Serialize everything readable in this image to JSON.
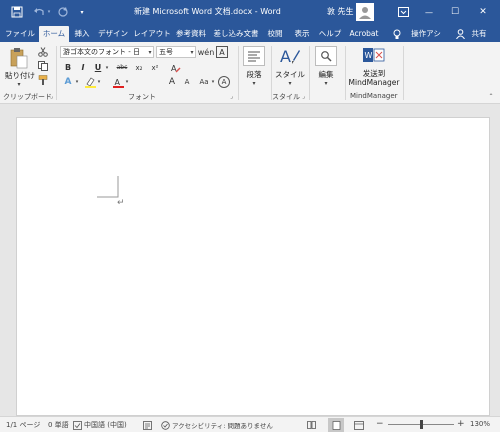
{
  "titlebar": {
    "doc_title": "新建 Microsoft Word 文档.docx  -  Word",
    "user": "敦 先生",
    "minimize": "—",
    "maximize": "☐",
    "close": "✕",
    "ribbon_display": "▣"
  },
  "tabs": [
    "ファイル",
    "ホーム",
    "挿入",
    "デザイン",
    "レイアウト",
    "参考資料",
    "差し込み文書",
    "校閲",
    "表示",
    "ヘルプ",
    "Acrobat"
  ],
  "tell_me": "操作アシ",
  "share": "共有",
  "ribbon": {
    "paste_label": "貼り付け",
    "clipboard_group": "クリップボード",
    "font_name": "游ゴ本文のフォント - 日",
    "font_size": "五号",
    "font_group": "フォント",
    "paragraph_label": "段落",
    "styles_label": "スタイル",
    "styles_group": "スタイル",
    "editing_label": "編集",
    "mindmanager_label1": "发送到",
    "mindmanager_label2": "MindManager",
    "mindmanager_group": "MindManager",
    "bold": "B",
    "italic": "I",
    "underline": "U",
    "strike": "abc",
    "subscript": "x₂",
    "superscript": "x²",
    "grow_font": "A",
    "shrink_font": "A",
    "aa": "Aa"
  },
  "document": {
    "paragraph_mark": "↵"
  },
  "statusbar": {
    "page": "1/1 ページ",
    "words": "0 単語",
    "language": "中国語 (中国)",
    "accessibility": "アクセシビリティ: 問題ありません",
    "zoom": "130%",
    "zoom_minus": "−",
    "zoom_plus": "+"
  },
  "colors": {
    "brand": "#2b579a",
    "ribbon_bg": "#f3f3f3",
    "workspace_bg": "#e6e6e6"
  }
}
